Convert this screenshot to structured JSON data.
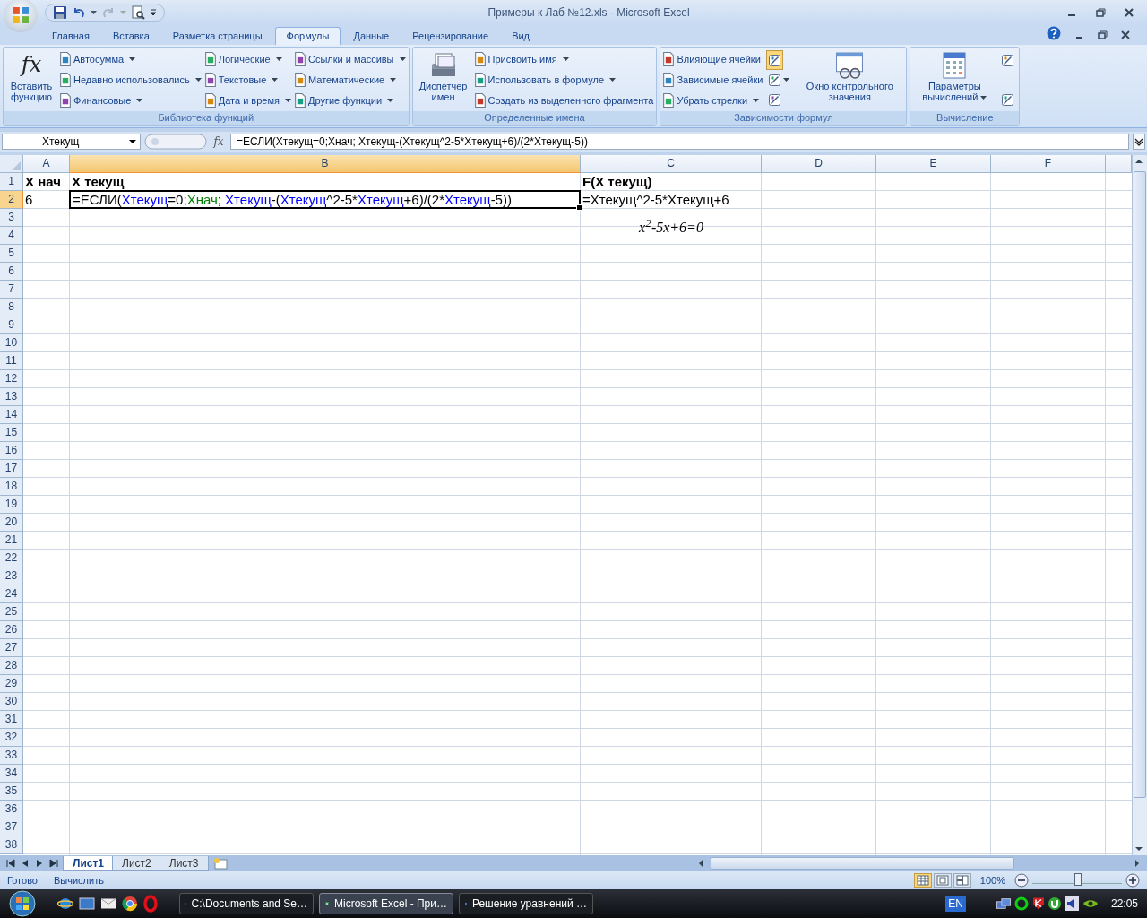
{
  "window": {
    "title": "Примеры к Лаб №12.xls - Microsoft Excel"
  },
  "tabs": [
    {
      "label": "Главная",
      "selected": false
    },
    {
      "label": "Вставка",
      "selected": false
    },
    {
      "label": "Разметка страницы",
      "selected": false
    },
    {
      "label": "Формулы",
      "selected": true
    },
    {
      "label": "Данные",
      "selected": false
    },
    {
      "label": "Рецензирование",
      "selected": false
    },
    {
      "label": "Вид",
      "selected": false
    }
  ],
  "ribbon": [
    {
      "label": "Библиотека функций",
      "columns": [
        {
          "kind": "large",
          "label": "Вставить функцию",
          "icon_text": "fx",
          "dropdown": false
        },
        {
          "kind": "small",
          "items": [
            {
              "label": "Автосумма",
              "dropdown": true
            },
            {
              "label": "Недавно использовались",
              "dropdown": true
            },
            {
              "label": "Финансовые",
              "dropdown": true
            }
          ]
        },
        {
          "kind": "small",
          "items": [
            {
              "label": "Логические",
              "dropdown": true
            },
            {
              "label": "Текстовые",
              "dropdown": true
            },
            {
              "label": "Дата и время",
              "dropdown": true
            }
          ]
        },
        {
          "kind": "small",
          "items": [
            {
              "label": "Ссылки и массивы",
              "dropdown": true
            },
            {
              "label": "Математические",
              "dropdown": true
            },
            {
              "label": "Другие функции",
              "dropdown": true
            }
          ]
        }
      ]
    },
    {
      "label": "Определенные имена",
      "columns": [
        {
          "kind": "large",
          "label": "Диспетчер имен",
          "dropdown": false
        },
        {
          "kind": "small",
          "items": [
            {
              "label": "Присвоить имя",
              "dropdown": true
            },
            {
              "label": "Использовать в формуле",
              "dropdown": true
            },
            {
              "label": "Создать из выделенного фрагмента",
              "dropdown": false
            }
          ]
        }
      ]
    },
    {
      "label": "Зависимости формул",
      "columns": [
        {
          "kind": "small",
          "items": [
            {
              "label": "Влияющие ячейки",
              "dropdown": false
            },
            {
              "label": "Зависимые ячейки",
              "dropdown": false
            },
            {
              "label": "Убрать стрелки",
              "dropdown": true
            }
          ]
        },
        {
          "kind": "icons",
          "items": [
            {
              "on": true,
              "dropdown": false
            },
            {
              "on": false,
              "dropdown": true
            },
            {
              "on": false,
              "dropdown": false
            }
          ]
        },
        {
          "kind": "large",
          "label": "Окно контрольного значения",
          "dropdown": false
        }
      ]
    },
    {
      "label": "Вычисление",
      "columns": [
        {
          "kind": "large",
          "label": "Параметры вычислений",
          "dropdown": true
        },
        {
          "kind": "icons",
          "items": [
            {
              "on": false,
              "dropdown": false
            },
            {
              "on": false,
              "dropdown": false
            }
          ]
        }
      ]
    }
  ],
  "formula_bar": {
    "name_box": "Хтекущ",
    "fx": "fx",
    "formula": "=ЕСЛИ(Хтекущ=0;Хнач; Хтекущ-(Хтекущ^2-5*Хтекущ+6)/(2*Хтекущ-5))"
  },
  "sheet": {
    "columns": [
      {
        "label": "A",
        "selected": false
      },
      {
        "label": "B",
        "selected": true
      },
      {
        "label": "C",
        "selected": false
      },
      {
        "label": "D",
        "selected": false
      },
      {
        "label": "E",
        "selected": false
      },
      {
        "label": "F",
        "selected": false
      }
    ],
    "rows": [
      {
        "header": "1",
        "selected": false,
        "cells": [
          {
            "kind": "text",
            "text": "Х нач",
            "bold": true,
            "selected": false
          },
          {
            "kind": "text",
            "text": "Х текущ",
            "bold": true,
            "selected": false
          },
          {
            "kind": "text",
            "text": "F(Х текущ)",
            "bold": true,
            "selected": false
          }
        ]
      },
      {
        "header": "2",
        "selected": true,
        "cells": [
          {
            "kind": "text",
            "text": "6",
            "bold": false,
            "selected": false
          },
          {
            "kind": "formula",
            "selected": true,
            "segments": [
              {
                "text": "=ЕСЛИ("
              },
              {
                "text": "Хтекущ",
                "color": "#0000ff"
              },
              {
                "text": "=0;"
              },
              {
                "text": "Хнач",
                "color": "#008000"
              },
              {
                "text": "; "
              },
              {
                "text": "Хтекущ",
                "color": "#0000ff"
              },
              {
                "text": "-("
              },
              {
                "text": "Хтекущ",
                "color": "#0000ff"
              },
              {
                "text": "^2-5*"
              },
              {
                "text": "Хтекущ",
                "color": "#0000ff"
              },
              {
                "text": "+6)/(2*"
              },
              {
                "text": "Хтекущ",
                "color": "#0000ff"
              },
              {
                "text": "-5))"
              }
            ]
          },
          {
            "kind": "text",
            "text": "=Хтекущ^2-5*Хтекущ+6",
            "bold": false,
            "selected": false
          }
        ]
      },
      {
        "header": "3",
        "selected": false,
        "cells": [
          {
            "kind": "blank"
          },
          {
            "kind": "blank"
          },
          {
            "kind": "equation",
            "text": "x$^{2}$-5x+6=0"
          }
        ]
      },
      {
        "header": "4",
        "selected": false
      },
      {
        "header": "5",
        "selected": false
      },
      {
        "header": "6",
        "selected": false
      },
      {
        "header": "7",
        "selected": false
      },
      {
        "header": "8",
        "selected": false
      },
      {
        "header": "9",
        "selected": false
      },
      {
        "header": "10",
        "selected": false
      },
      {
        "header": "11",
        "selected": false
      },
      {
        "header": "12",
        "selected": false
      },
      {
        "header": "13",
        "selected": false
      },
      {
        "header": "14",
        "selected": false
      },
      {
        "header": "15",
        "selected": false
      },
      {
        "header": "16",
        "selected": false
      },
      {
        "header": "17",
        "selected": false
      },
      {
        "header": "18",
        "selected": false
      },
      {
        "header": "19",
        "selected": false
      },
      {
        "header": "20",
        "selected": false
      },
      {
        "header": "21",
        "selected": false
      },
      {
        "header": "22",
        "selected": false
      },
      {
        "header": "23",
        "selected": false
      },
      {
        "header": "24",
        "selected": false
      },
      {
        "header": "25",
        "selected": false
      },
      {
        "header": "26",
        "selected": false
      },
      {
        "header": "27",
        "selected": false
      },
      {
        "header": "28",
        "selected": false
      },
      {
        "header": "29",
        "selected": false
      },
      {
        "header": "30",
        "selected": false
      },
      {
        "header": "31",
        "selected": false
      },
      {
        "header": "32",
        "selected": false
      },
      {
        "header": "33",
        "selected": false
      },
      {
        "header": "34",
        "selected": false
      },
      {
        "header": "35",
        "selected": false
      },
      {
        "header": "36",
        "selected": false
      },
      {
        "header": "37",
        "selected": false
      },
      {
        "header": "38",
        "selected": false
      }
    ]
  },
  "sheet_tabs": [
    {
      "label": "Лист1",
      "selected": true
    },
    {
      "label": "Лист2",
      "selected": false
    },
    {
      "label": "Лист3",
      "selected": false
    }
  ],
  "status_bar": {
    "items": [
      "Готово",
      "Вычислить"
    ],
    "views": [
      {
        "selected": true
      },
      {
        "selected": false
      },
      {
        "selected": false
      }
    ],
    "zoom": "100%",
    "zoom_slider": {
      "level": 0.5
    }
  },
  "taskbar": {
    "tasks": [
      {
        "label": "C:\\Documents and Se…",
        "selected": false
      },
      {
        "label": "Microsoft Excel - При…",
        "selected": true
      },
      {
        "label": "Решение уравнений …",
        "selected": false
      }
    ],
    "language": "EN",
    "clock": "22:05"
  }
}
